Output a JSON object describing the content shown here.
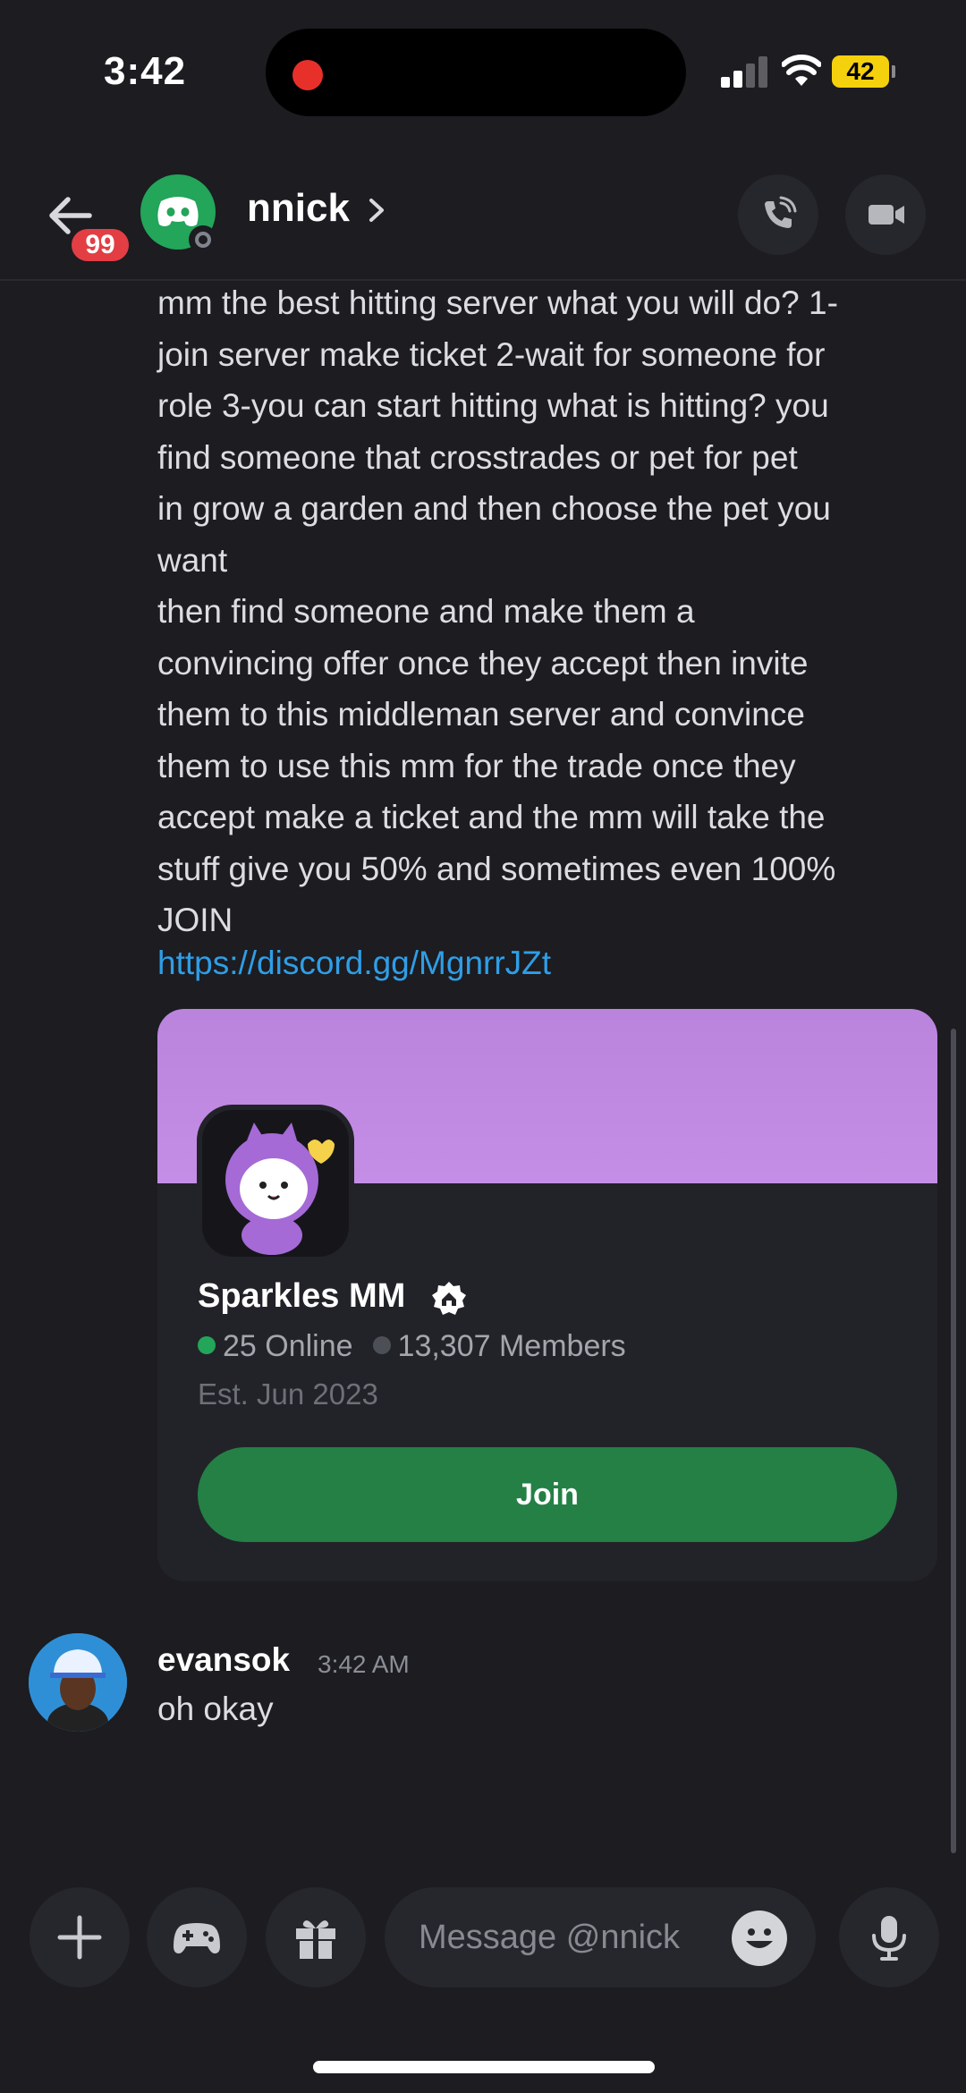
{
  "status_bar": {
    "time": "3:42",
    "battery": "42"
  },
  "header": {
    "unread_badge": "99",
    "username": "nnick",
    "icons": {
      "back": "arrow-left-icon",
      "avatar": "discord-logo-icon",
      "chevron": "chevron-right-icon",
      "call": "phone-call-icon",
      "video": "video-camera-icon"
    }
  },
  "messages": {
    "first": {
      "text": "mm the best hitting server what you will do? 1-\njoin server make ticket 2-wait for someone for\nrole 3-you can start hitting what is hitting? you\nfind someone that crosstrades or pet for pet\nin grow a garden and then choose the pet you\nwant\nthen find someone and make them a\nconvincing offer once they accept then invite\nthem to this middleman server and convince\nthem to use this mm for the trade once they\naccept make a ticket and the mm will take the\nstuff give you 50% and sometimes even 100%\nJOIN",
      "link": "https://discord.gg/MgnrrJZt"
    },
    "invite": {
      "server_name": "Sparkles MM",
      "online": "25 Online",
      "members": "13,307 Members",
      "established": "Est. Jun 2023",
      "join_label": "Join",
      "banner_color": "#c48ee6",
      "online_color": "#23a55a"
    },
    "reply": {
      "author": "evansok",
      "time": "3:42 AM",
      "text": "oh okay"
    }
  },
  "composer": {
    "placeholder": "Message @nnick",
    "icons": [
      "plus-icon",
      "gamepad-icon",
      "gift-icon",
      "emoji-icon",
      "microphone-icon"
    ]
  },
  "colors": {
    "background": "#1c1c21",
    "accent_green": "#248045",
    "link": "#2f9ee6"
  }
}
